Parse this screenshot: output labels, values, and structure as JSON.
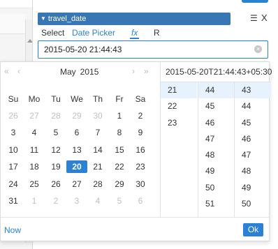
{
  "field": {
    "title": "travel_date",
    "list_icon": "list-icon",
    "close_label": "X"
  },
  "tabs": [
    "Select",
    "Date Picker",
    "fx",
    "R"
  ],
  "input": {
    "value": "2015-05-20 21:44:43",
    "clear_icon": "×"
  },
  "calendar": {
    "nav": {
      "double_prev": "«",
      "prev": "‹",
      "next": "›",
      "double_next": "»"
    },
    "month": "May",
    "year": "2015",
    "weekdays": [
      "Su",
      "Mo",
      "Tu",
      "We",
      "Th",
      "Fr",
      "Sa"
    ],
    "weeks": [
      [
        {
          "d": "26",
          "o": true
        },
        {
          "d": "27",
          "o": true
        },
        {
          "d": "28",
          "o": true
        },
        {
          "d": "29",
          "o": true
        },
        {
          "d": "30",
          "o": true
        },
        {
          "d": "1"
        },
        {
          "d": "2"
        }
      ],
      [
        {
          "d": "3"
        },
        {
          "d": "4"
        },
        {
          "d": "5"
        },
        {
          "d": "6"
        },
        {
          "d": "7"
        },
        {
          "d": "8"
        },
        {
          "d": "9"
        }
      ],
      [
        {
          "d": "10"
        },
        {
          "d": "11"
        },
        {
          "d": "12"
        },
        {
          "d": "13"
        },
        {
          "d": "14"
        },
        {
          "d": "15"
        },
        {
          "d": "16"
        }
      ],
      [
        {
          "d": "17"
        },
        {
          "d": "18"
        },
        {
          "d": "19"
        },
        {
          "d": "20",
          "sel": true
        },
        {
          "d": "21"
        },
        {
          "d": "22"
        },
        {
          "d": "23"
        }
      ],
      [
        {
          "d": "24"
        },
        {
          "d": "25"
        },
        {
          "d": "26"
        },
        {
          "d": "27"
        },
        {
          "d": "28"
        },
        {
          "d": "29"
        },
        {
          "d": "30"
        }
      ],
      [
        {
          "d": "31"
        },
        {
          "d": "1",
          "o": true
        },
        {
          "d": "2",
          "o": true
        },
        {
          "d": "3",
          "o": true
        },
        {
          "d": "4",
          "o": true
        },
        {
          "d": "5",
          "o": true
        },
        {
          "d": "6",
          "o": true
        }
      ]
    ]
  },
  "time": {
    "display": "2015-05-20T21:44:43+05:30",
    "hours": [
      "21",
      "22",
      "23"
    ],
    "minutes": [
      "44",
      "45",
      "46",
      "47",
      "48",
      "49",
      "50",
      "51"
    ],
    "seconds": [
      "43",
      "44",
      "45",
      "46",
      "47",
      "48",
      "49",
      "50"
    ],
    "selected": {
      "hour": "21",
      "minute": "44",
      "second": "43"
    }
  },
  "footer": {
    "now_label": "Now",
    "ok_label": "Ok"
  }
}
